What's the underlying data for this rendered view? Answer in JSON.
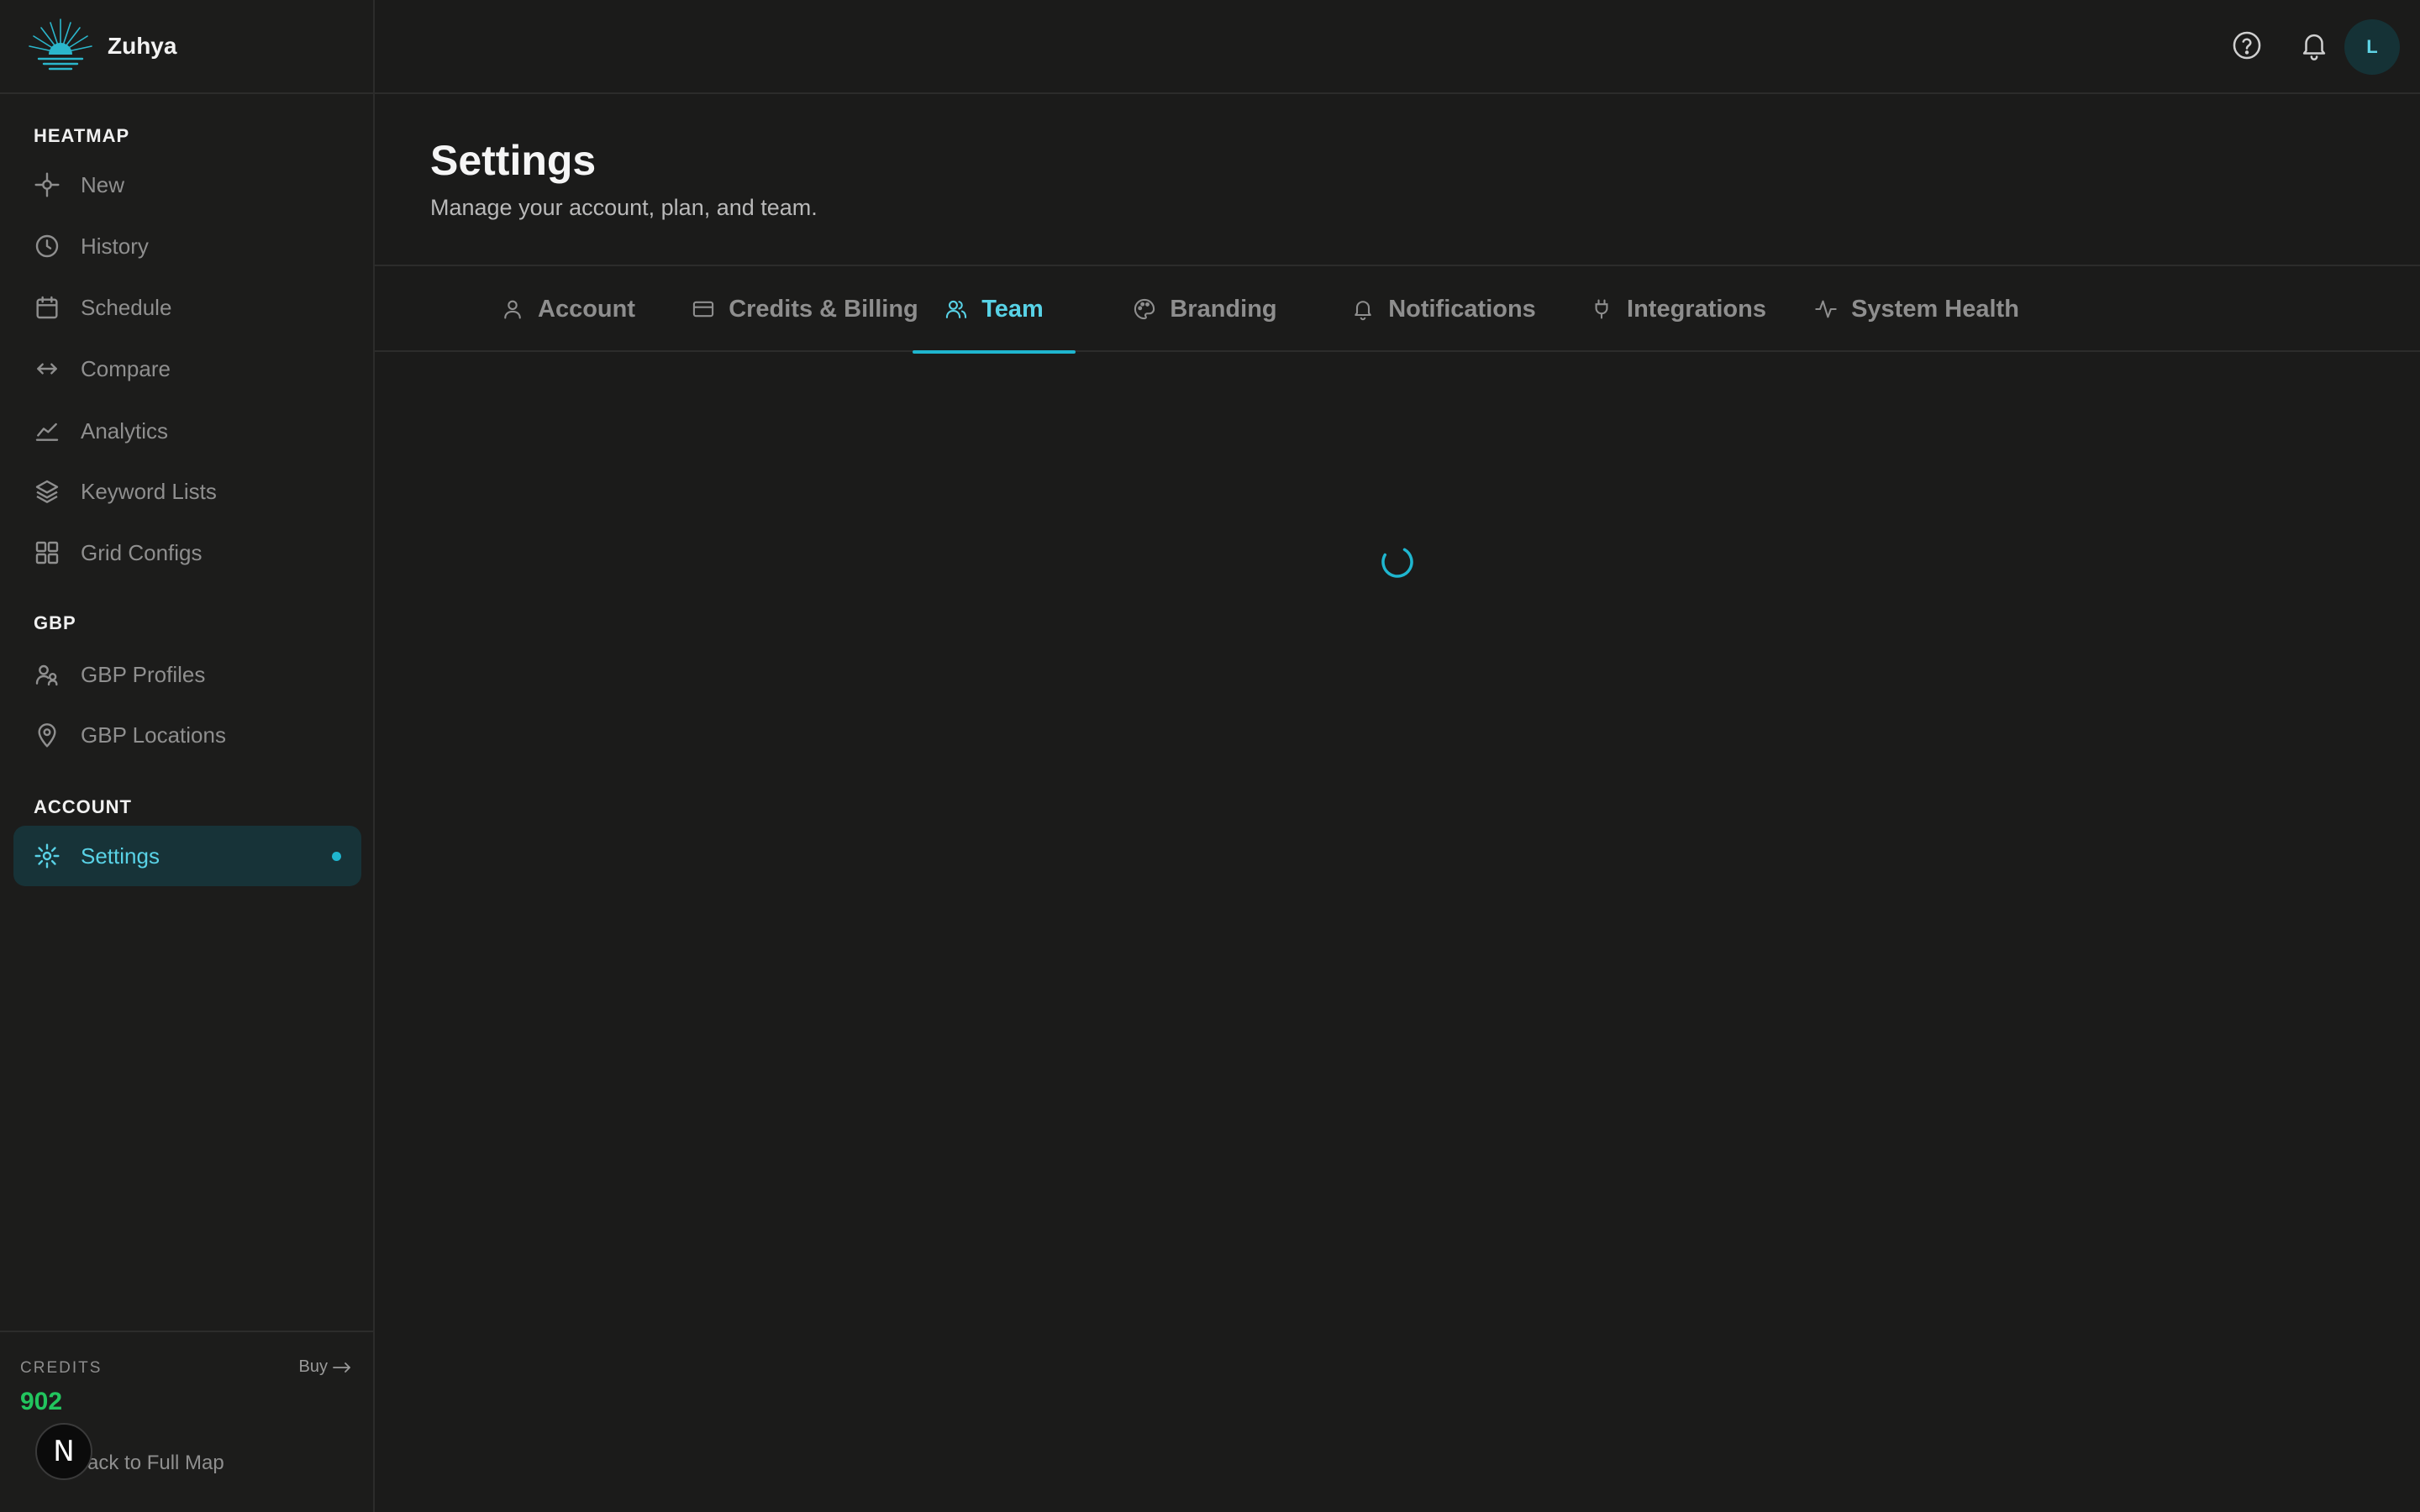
{
  "app": {
    "name": "Zuhya"
  },
  "sidebar": {
    "sections": {
      "heatmap": "HEATMAP",
      "gbp": "GBP",
      "account": "ACCOUNT"
    },
    "items": [
      {
        "label": "New",
        "icon": "crosshair-icon"
      },
      {
        "label": "History",
        "icon": "clock-icon"
      },
      {
        "label": "Schedule",
        "icon": "calendar-icon"
      },
      {
        "label": "Compare",
        "icon": "arrows-horizontal-icon"
      },
      {
        "label": "Analytics",
        "icon": "chart-line-icon"
      },
      {
        "label": "Keyword Lists",
        "icon": "layers-icon"
      },
      {
        "label": "Grid Configs",
        "icon": "grid-icon"
      },
      {
        "label": "GBP Profiles",
        "icon": "users-icon"
      },
      {
        "label": "GBP Locations",
        "icon": "map-pin-icon"
      },
      {
        "label": "Settings",
        "icon": "gear-icon",
        "active": true
      }
    ],
    "credits": {
      "label": "CREDITS",
      "value": "902",
      "buy": "Buy"
    },
    "back_link": "Back to Full Map",
    "dev_badge": "N"
  },
  "header": {
    "avatar_initial": "L"
  },
  "page": {
    "title": "Settings",
    "subtitle": "Manage your account, plan, and team."
  },
  "tabs": [
    {
      "label": "Account",
      "icon": "user-icon"
    },
    {
      "label": "Credits & Billing",
      "icon": "credit-card-icon"
    },
    {
      "label": "Team",
      "icon": "team-icon",
      "active": true
    },
    {
      "label": "Branding",
      "icon": "palette-icon"
    },
    {
      "label": "Notifications",
      "icon": "bell-icon"
    },
    {
      "label": "Integrations",
      "icon": "plug-icon"
    },
    {
      "label": "System Health",
      "icon": "activity-icon"
    }
  ],
  "colors": {
    "accent": "#1fb6cf",
    "credits": "#22c55e",
    "background": "#1b1b1a"
  }
}
